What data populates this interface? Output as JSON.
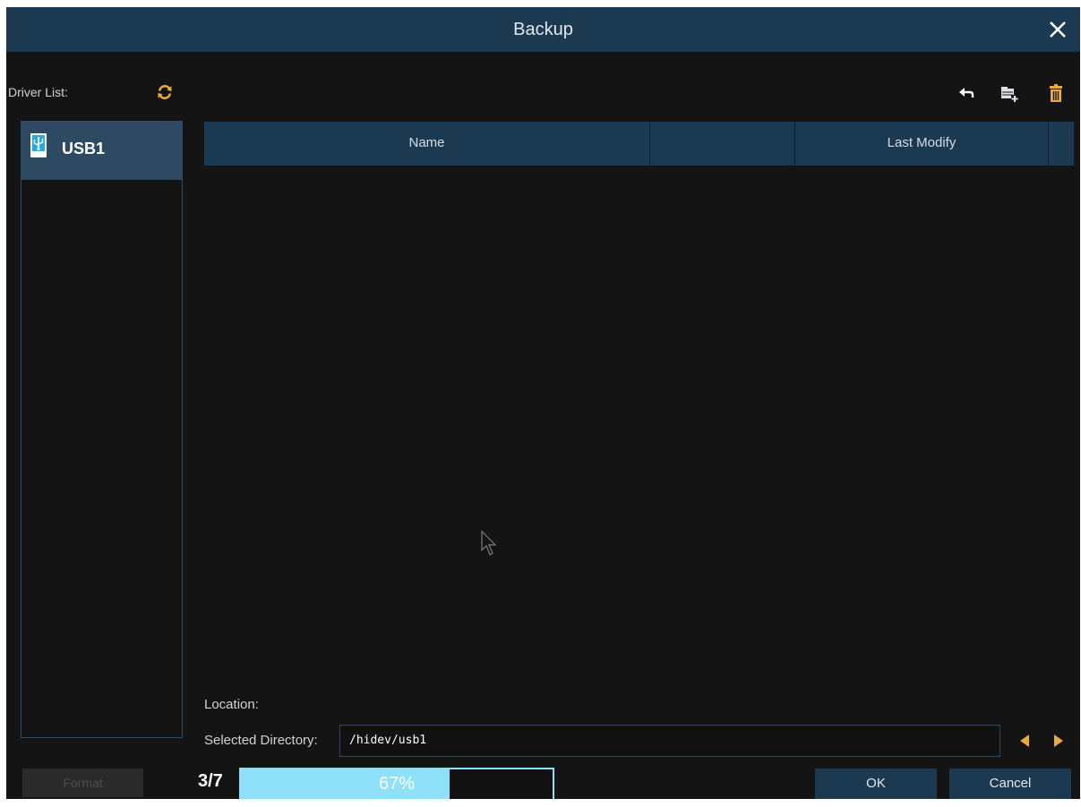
{
  "dialog": {
    "title": "Backup",
    "close_icon": "close-icon"
  },
  "sidebar": {
    "driver_list_label": "Driver List:",
    "refresh_icon": "refresh-icon",
    "drives": [
      {
        "label": "USB1",
        "icon": "usb-icon",
        "selected": true
      }
    ]
  },
  "toolbar": {
    "icons": [
      "back-arrow-icon",
      "new-folder-icon",
      "trash-icon"
    ]
  },
  "file_table": {
    "columns": [
      "Name",
      "",
      "Last Modify",
      ""
    ],
    "rows": []
  },
  "location": {
    "location_label": "Location:",
    "selected_directory_label": "Selected Directory:",
    "selected_directory_value": "/hidev/usb1",
    "nav_icons": [
      "arrow-left-icon",
      "arrow-right-icon"
    ]
  },
  "footer": {
    "format_label": "Format",
    "page_count": "3/7",
    "progress_text": "67%",
    "progress_fraction": 0.67,
    "ok_label": "OK",
    "cancel_label": "Cancel"
  },
  "colors": {
    "title_bar": "#1b3a52",
    "background": "#141414",
    "accent_icon": "#e8a93e",
    "progress_fill": "#8ee1f8",
    "selected_item": "#2e4a62"
  }
}
